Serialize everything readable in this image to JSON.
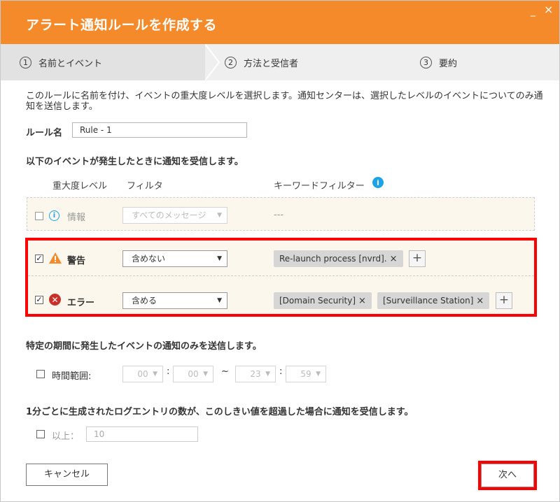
{
  "window": {
    "title": "アラート通知ルールを作成する",
    "minimize_glyph": "_",
    "close_glyph": "×",
    "accent_color": "#f58a2a"
  },
  "steps": [
    {
      "number": "1",
      "label": "名前とイベント"
    },
    {
      "number": "2",
      "label": "方法と受信者"
    },
    {
      "number": "3",
      "label": "要約"
    }
  ],
  "description": "このルールに名前を付け、イベントの重大度レベルを選択します。通知センターは、選択したレベルのイベントについてのみ通知を送信します。",
  "rule_name": {
    "label": "ルール名",
    "value": "Rule - 1"
  },
  "events_heading": "以下のイベントが発生したときに通知を受信します。",
  "columns": {
    "severity": "重大度レベル",
    "filter": "フィルタ",
    "keyword": "キーワードフィルター"
  },
  "severity_rows": {
    "info": {
      "label": "情報",
      "checked": false,
      "filter": "すべてのメッセージ",
      "keyword_placeholder": "---",
      "icon": "info-icon"
    },
    "warning": {
      "label": "警告",
      "checked": true,
      "check_glyph": "✓",
      "filter": "含めない",
      "tags": [
        "Re-launch process [nvrd]."
      ],
      "icon": "warning-icon"
    },
    "error": {
      "label": "エラー",
      "checked": true,
      "check_glyph": "✓",
      "filter": "含める",
      "tags": [
        "[Domain Security]",
        "[Surveillance Station]"
      ],
      "icon": "error-icon"
    }
  },
  "tag_remove_glyph": "×",
  "add_glyph": "+",
  "time_section": {
    "heading": "特定の期間に発生したイベントの通知のみを送信します。",
    "checkbox_label": "時間範囲:",
    "start_hour": "00",
    "start_minute": "00",
    "range_sep": "~",
    "end_hour": "23",
    "end_minute": "59",
    "colon": ":"
  },
  "threshold_section": {
    "heading": "1分ごとに生成されたログエントリの数が、このしきい値を超過した場合に通知を受信します。",
    "checkbox_label": "以上：",
    "value": "10"
  },
  "buttons": {
    "cancel": "キャンセル",
    "next": "次へ"
  },
  "highlight_color": "#ff0000"
}
